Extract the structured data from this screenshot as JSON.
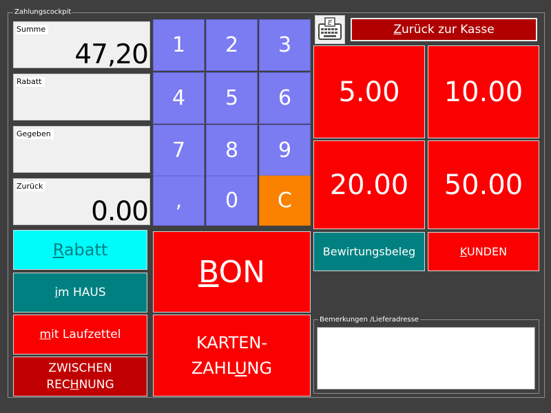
{
  "cockpit": {
    "title": "Zahlungscockpit"
  },
  "fields": {
    "summe": {
      "label": "Summe",
      "value": "47,20"
    },
    "rabatt": {
      "label": "Rabatt",
      "value": ""
    },
    "gegeben": {
      "label": "Gegeben",
      "value": ""
    },
    "zurueck": {
      "label": "Zurück",
      "value": "0.00"
    }
  },
  "keypad": {
    "k1": "1",
    "k2": "2",
    "k3": "3",
    "k4": "4",
    "k5": "5",
    "k6": "6",
    "k7": "7",
    "k8": "8",
    "k9": "9",
    "comma": ",",
    "k0": "0",
    "clear": "C"
  },
  "actions": {
    "rabatt": {
      "u": "R",
      "rest": "abatt"
    },
    "im_haus": {
      "u": "i",
      "rest": "m HAUS"
    },
    "laufzettel": {
      "u": "m",
      "rest": "it Laufzettel"
    },
    "zwischen": {
      "line1": "ZWISCHEN",
      "pre": "REC",
      "u": "H",
      "post": "NUNG"
    },
    "bon": {
      "u": "B",
      "rest": "ON"
    },
    "karten": {
      "line1": "KARTEN-",
      "pre": "ZAHL",
      "u": "U",
      "post": "NG"
    }
  },
  "top": {
    "keyboard_icon": "keyboard-icon",
    "back": {
      "u": "Z",
      "rest": "urück zur Kasse"
    }
  },
  "money": {
    "m5": "5.00",
    "m10": "10.00",
    "m20": "20.00",
    "m50": "50.00"
  },
  "side": {
    "bewirtung": {
      "pre": "Bewirtungsbele",
      "u": "g",
      "post": ""
    },
    "kunden": {
      "u": "K",
      "rest": "UNDEN"
    }
  },
  "remarks": {
    "title": "Bemerkungen /Lieferadresse",
    "value": ""
  },
  "colors": {
    "background": "#3f3f3f",
    "red": "#fb0000",
    "dark_red": "#c00000",
    "teal": "#008080",
    "cyan": "#00fbfb",
    "keypad": "#7b7bf2",
    "orange": "#fb8200"
  }
}
